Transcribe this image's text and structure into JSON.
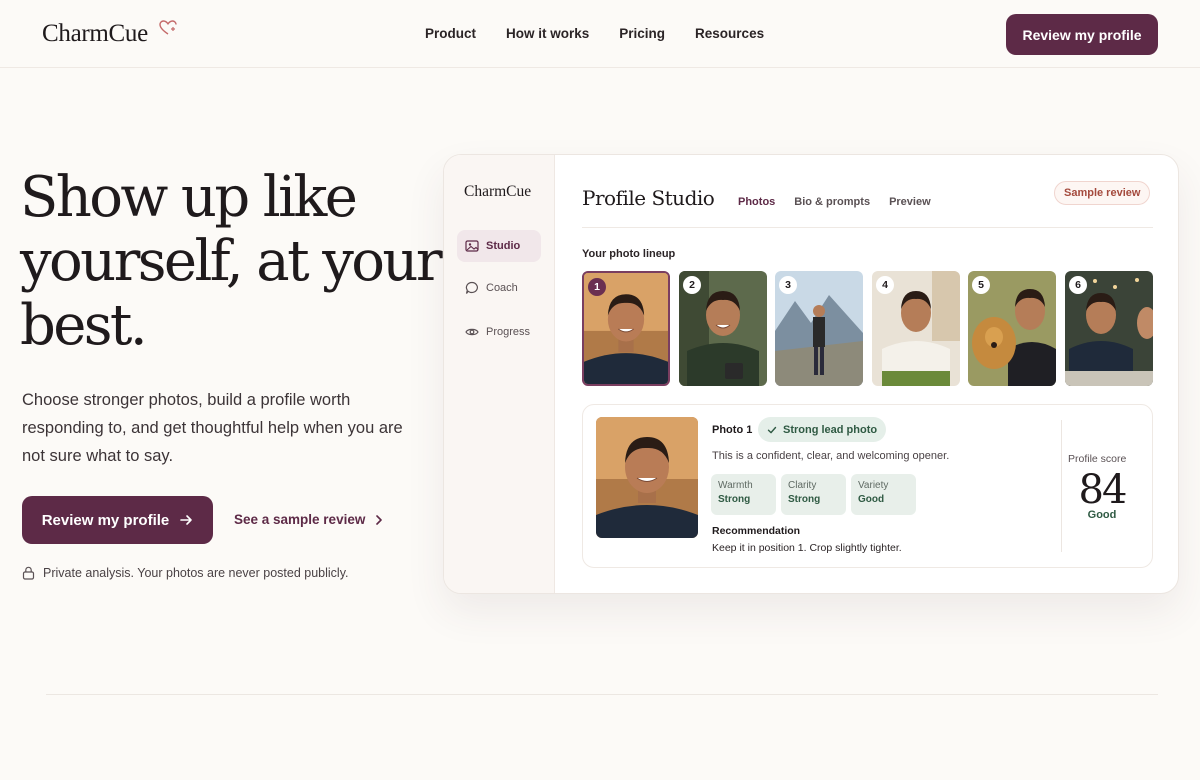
{
  "brand": {
    "name": "CharmCue"
  },
  "nav": {
    "items": [
      "Product",
      "How it works",
      "Pricing",
      "Resources"
    ]
  },
  "header": {
    "cta": "Review my profile"
  },
  "hero": {
    "title": "Show up like yourself, at your best.",
    "subtitle": "Choose stronger photos, build a profile worth responding to, and get thoughtful help when you are not sure what to say.",
    "cta": "Review my profile",
    "secondary": "See a sample review",
    "privacy": "Private analysis. Your photos are never posted publicly."
  },
  "app": {
    "logo": "CharmCue",
    "sidebar": [
      {
        "label": "Studio",
        "icon": "image-icon",
        "active": true
      },
      {
        "label": "Coach",
        "icon": "chat-bubble-icon",
        "active": false
      },
      {
        "label": "Progress",
        "icon": "eye-icon",
        "active": false
      }
    ],
    "title": "Profile Studio",
    "tabs": [
      {
        "label": "Photos",
        "active": true
      },
      {
        "label": "Bio & prompts",
        "active": false
      },
      {
        "label": "Preview",
        "active": false
      }
    ],
    "badge": "Sample review",
    "lineup_label": "Your photo lineup",
    "photos": [
      "1",
      "2",
      "3",
      "4",
      "5",
      "6"
    ],
    "selected": {
      "title": "Photo 1",
      "badge": "Strong lead photo",
      "description": "This is a confident, clear, and welcoming opener.",
      "metrics": [
        {
          "label": "Warmth",
          "value": "Strong"
        },
        {
          "label": "Clarity",
          "value": "Strong"
        },
        {
          "label": "Variety",
          "value": "Good"
        }
      ],
      "recommendation_title": "Recommendation",
      "recommendation": "Keep it in position 1. Crop slightly tighter."
    },
    "score": {
      "label": "Profile score",
      "value": "84",
      "word": "Good"
    }
  },
  "colors": {
    "accent": "#5d2a47",
    "success": "#2f5a43",
    "background": "#fcfaf7"
  }
}
